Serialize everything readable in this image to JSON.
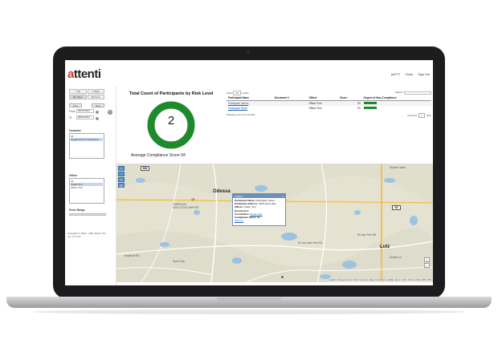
{
  "app": {
    "logo_accent": "a",
    "logo_rest": "ttenti",
    "brand_color": "#c0392b"
  },
  "topbar": {
    "user": "jmt777",
    "close": "Close",
    "signout": "Sign Out"
  },
  "sidebar": {
    "tabs": [
      "< Mo",
      "7 Days",
      "By Days",
      "By Hour"
    ],
    "prev": "Prev",
    "next": "Next",
    "from_label": "From",
    "from_value": "06/01/2021",
    "to_label": "To",
    "to_value": "06/01/2021",
    "customer_label": "Customer",
    "customer_items": [
      "All",
      "Department of Corrections"
    ],
    "officer_label": "Officer",
    "officer_items": [
      "All",
      "Onkar Tom",
      "Officer Tom"
    ],
    "score_label": "Score Range",
    "copyright": "Copyright © 2020 - 2021 attenti US, Inc. v1.1.0.5"
  },
  "donut": {
    "title": "Total Count of Participants by Risk Level",
    "count": "2",
    "caption": "Average Compliance Score 94",
    "color": "#1f8a2b"
  },
  "table": {
    "show_label": "Show",
    "show_value": "10",
    "entries": "entries",
    "search_label": "Search:",
    "headers": [
      "Participant Name",
      "Document #",
      "Officer",
      "Score ↑",
      "Degree of Non-Compliance"
    ],
    "rows": [
      {
        "name": "Participant James",
        "doc": "",
        "officer": "Officer Tom",
        "score": "94",
        "bar": 0.55
      },
      {
        "name": "Participant Steve",
        "doc": "",
        "officer": "Officer Tom",
        "score": "94",
        "bar": 0.55
      }
    ],
    "footer": "Showing 1 to 2 of 2 entries",
    "prev": "Previous",
    "page": "1",
    "next": "Next"
  },
  "map": {
    "labels": {
      "odessa": "Odessa",
      "airport": "TAMPA BAY EXECUTIVE AIRPORT",
      "lutz": "Lutz",
      "sunset": "Sunset La",
      "keystone": "Keystone Rd",
      "gunn": "Gunn Hwy",
      "lake_fern": "W Lake Fern Rd",
      "lutz_lake": "W Lutz Lake Fern Rd",
      "dupree": "Dupree Lakes",
      "hwy54": "54",
      "hwy589": "589"
    },
    "popup": {
      "header": "Lifelabs",
      "name_label": "Participant Name:",
      "name_value": "Participant, Steve",
      "addr_label": "Participant Address:",
      "addr_value": "3449 Gunn Hwy",
      "officer_label": "Officer:",
      "officer_value": "Onkar, Tom",
      "doc_label": "Document #:",
      "coord_label": "Coordinates:",
      "map_link": "Street View",
      "score_label": "Compliance Score:",
      "score_value": "94",
      "zoom_link": "Zoom to"
    },
    "attribution": "Leaflet | Powered by Esri | Esri Community Maps Contributors, HERE, Garmin, FAO, NOAA, USGS, EPA, NPS"
  }
}
